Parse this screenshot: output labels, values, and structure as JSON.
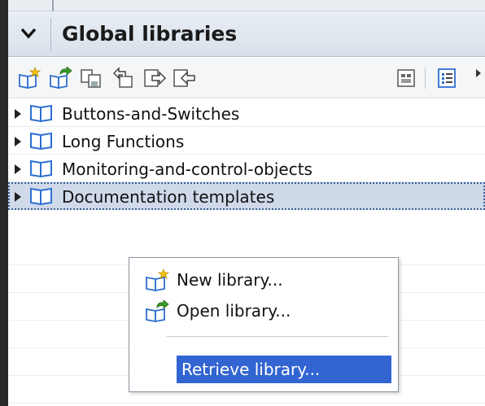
{
  "panel": {
    "title": "Global libraries"
  },
  "toolbar": {
    "buttons": [
      {
        "icon": "create-library-icon"
      },
      {
        "icon": "open-library-icon"
      },
      {
        "icon": "save-library-icon"
      },
      {
        "icon": "undo-icon"
      },
      {
        "icon": "export-icon"
      },
      {
        "icon": "import-icon"
      },
      {
        "icon": "library-view-icon"
      },
      {
        "icon": "list-details-icon"
      }
    ]
  },
  "libraries": [
    {
      "label": "Buttons-and-Switches"
    },
    {
      "label": "Long Functions"
    },
    {
      "label": "Monitoring-and-control-objects"
    },
    {
      "label": "Documentation templates",
      "selected": true
    }
  ],
  "context_menu": {
    "items": [
      {
        "label": "New library...",
        "icon": "new-library-icon"
      },
      {
        "label": "Open library...",
        "icon": "open-library-icon"
      },
      {
        "label": "Retrieve library...",
        "highlighted": true
      }
    ]
  },
  "colors": {
    "header_bg": "#dce4ec",
    "selection_bg": "#cfd9ea",
    "menu_highlight": "#3264d2",
    "book_blue": "#2d6fd0"
  }
}
